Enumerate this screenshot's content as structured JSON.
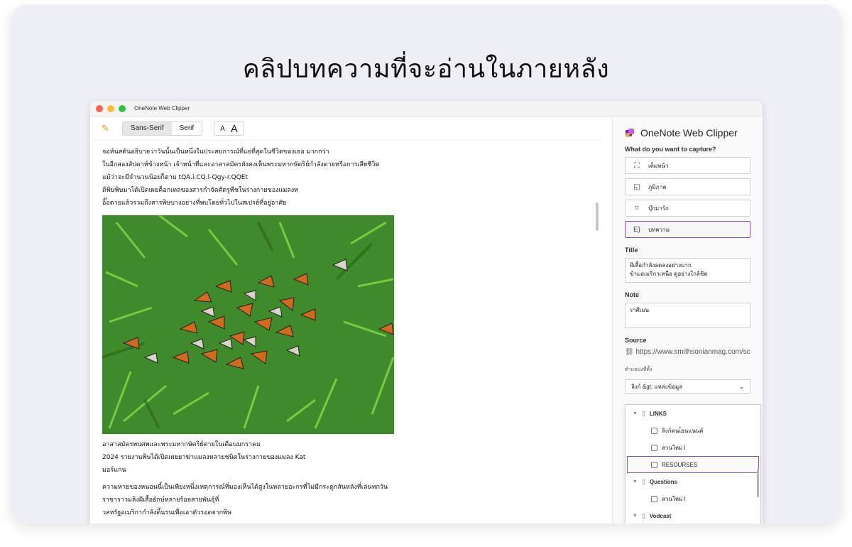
{
  "headline": "คลิปบทความที่จะอ่านในภายหลัง",
  "window": {
    "title": "OneNote Web Clipper"
  },
  "toolbar": {
    "sans_serif": "Sans-Serif",
    "serif": "Serif",
    "font_small": "A",
    "font_large": "A"
  },
  "article": {
    "lines_top": [
      "จอห์นสตันอธิบายว่าวันนั้นเป็นหนึ่งในประสบการณ์ที่แย่ที่สุดในชีวิตของเธอ                                   มากกว่า",
      "ในอีกสองสัปดาห์ข้างหน้า เจ้าหน้าที่และอาสาสมัครยังคงเห็นพระมหากษัตริย์กำลังตายหรือการเสียชีวิต",
      "แม้ว่าจะมีจำนวนน้อยก็ตาม tQA.i.CQ.l-Qgy-r.QQEt",
      "ดิพิษพิษมาได้เปิดเผยค็อกเทลของสารกำจัดศัตรูพืชในร่างกายของแมลงท",
      "อิ๊อตายแล้วรวมถึงสารพิษบางอย่างที่พบโดยทั่วไปในสเปรย์ที่อยู่อาศัย"
    ],
    "lines_bottom": [
      "อาสาสมัครพบศพและพระมหากษัตริย์ตายในเดือนมกราคม",
      "2024 รายงานพิษได้เปิดเผยยาฆ่าแมลงหลายชนิดในร่างกายของแมลง                                    Kat",
      "มอร์แกน",
      "ความหายของหนอนนี้เป็นเพียงหนึ่งเหตุการณ์ที่มองเห็นได้สูงในหลายอะกรที่ไม่มีกระดูกสันหลังที่เล่นทกวัน",
      "ราชาราวมลิงผีเสื้อยักษ์หลายร้อยสายพันธุ์ที่",
      "วสหรัฐอเมริกากำลังดิ้นรนเพื่อเอาตัวรอดจากพิษ"
    ]
  },
  "panel": {
    "title": "OneNote Web Clipper",
    "capture_label": "What do you want to capture?",
    "options": [
      {
        "icon": "full-page-icon",
        "label": "เต็มหน้า"
      },
      {
        "icon": "region-icon",
        "label": "ภูมิภาค"
      },
      {
        "icon": "bookmark-icon",
        "label": "บุ๊กมาร์ก"
      },
      {
        "icon": "article-icon",
        "label": "บทความ"
      }
    ],
    "title_label": "Title",
    "title_value_1": "ผีเสื้อกำลังลดลงอย่างมาก",
    "title_value_2": "ข้ามอเมริกาเหนือ ดูอย่างใกล้ชิด",
    "note_label": "Note",
    "note_value": "ราศีเมษ",
    "source_label": "Source",
    "source_value": "https://www.smithsonianmag.com/sci...",
    "location_label": "ตำแหน่งที่ตั้ง",
    "location_value": "ลิงก์ &gt; แหล่งข้อมูล",
    "dropdown": {
      "links": "LINKS",
      "links_page1": "ลิงก์ตนเ้อนแนนต์",
      "links_page2": "สวนใหม่ l",
      "links_page3": "RESOURSES",
      "questions": "Questions",
      "questions_page1": "สวนใหม่ l",
      "vodcast": "Vodcast"
    }
  }
}
